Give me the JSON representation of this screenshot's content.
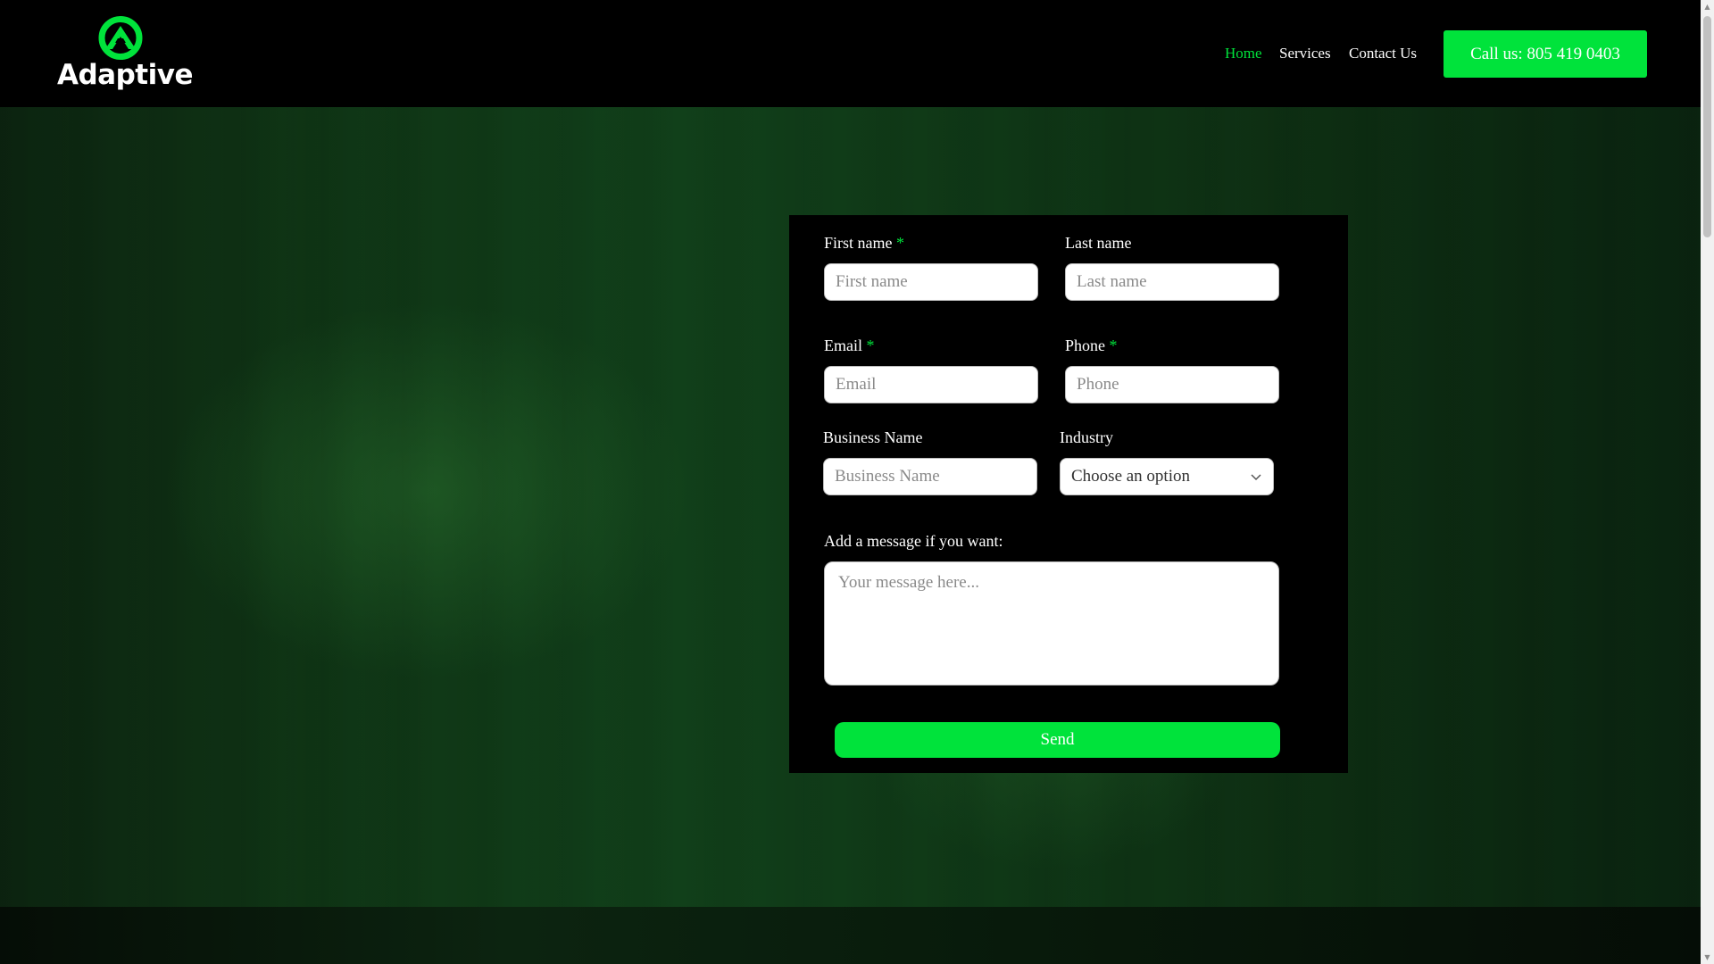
{
  "brand": {
    "name": "Adaptive",
    "accent_color": "#00e33b",
    "icon": "adaptive-a-logo-icon"
  },
  "nav": {
    "items": [
      {
        "label": "Home",
        "active": true
      },
      {
        "label": "Services",
        "active": false
      },
      {
        "label": "Contact Us",
        "active": false
      }
    ],
    "call_button": "Call us: 805 419 0403"
  },
  "form": {
    "required_marker": "*",
    "first_name": {
      "label": "First name",
      "placeholder": "First name",
      "required": true
    },
    "last_name": {
      "label": "Last name",
      "placeholder": "Last name",
      "required": false
    },
    "email": {
      "label": "Email",
      "placeholder": "Email",
      "required": true
    },
    "phone": {
      "label": "Phone",
      "placeholder": "Phone",
      "required": true
    },
    "business_name": {
      "label": "Business Name",
      "placeholder": "Business Name",
      "required": false
    },
    "industry": {
      "label": "Industry",
      "selected": "Choose an option",
      "icon": "chevron-down-icon"
    },
    "message": {
      "label": "Add a message if you want:",
      "placeholder": "Your message here..."
    },
    "submit_label": "Send"
  }
}
